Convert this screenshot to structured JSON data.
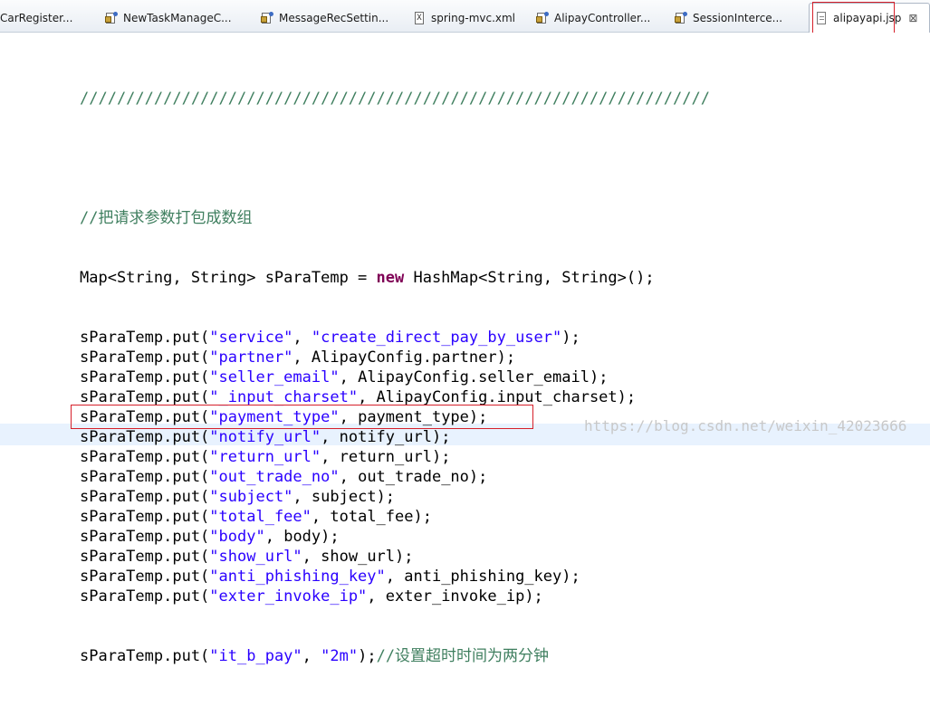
{
  "tabs": [
    {
      "label": "CarRegister...",
      "icon": "java-class-icon"
    },
    {
      "label": "NewTaskManageC...",
      "icon": "java-class-icon"
    },
    {
      "label": "MessageRecSettin...",
      "icon": "java-class-icon"
    },
    {
      "label": "spring-mvc.xml",
      "icon": "xml-file-icon",
      "icon_glyph": "X"
    },
    {
      "label": "AlipayController...",
      "icon": "java-class-icon"
    },
    {
      "label": "SessionInterce...",
      "icon": "java-class-icon"
    },
    {
      "label": "alipayapi.jsp",
      "icon": "jsp-file-icon",
      "active": true,
      "close_glyph": "⊠"
    }
  ],
  "editor": {
    "separator": "////////////////////////////////////////////////////////////////////",
    "comment_pack": "//把请求参数打包成数组",
    "map_decl": {
      "prefix": "Map<String, String> sParaTemp = ",
      "keyword": "new",
      "suffix": " HashMap<String, String>();"
    },
    "put_prefix": "sParaTemp.put(",
    "puts": [
      {
        "key": "\"service\"",
        "sep": ", ",
        "value": "\"create_direct_pay_by_user\"",
        "value_is_string": true,
        "end": ");"
      },
      {
        "key": "\"partner\"",
        "sep": ", ",
        "value": "AlipayConfig.partner",
        "value_is_string": false,
        "end": ");"
      },
      {
        "key": "\"seller_email\"",
        "sep": ", ",
        "value": "AlipayConfig.seller_email",
        "value_is_string": false,
        "end": ");"
      },
      {
        "key": "\"_input_charset\"",
        "sep": ", ",
        "value": "AlipayConfig.input_charset",
        "value_is_string": false,
        "end": ");"
      },
      {
        "key": "\"payment_type\"",
        "sep": ", ",
        "value": "payment_type",
        "value_is_string": false,
        "end": ");"
      },
      {
        "key": "\"notify_url\"",
        "sep": ", ",
        "value": "notify_url",
        "value_is_string": false,
        "end": ");"
      },
      {
        "key": "\"return_url\"",
        "sep": ", ",
        "value": "return_url",
        "value_is_string": false,
        "end": ");"
      },
      {
        "key": "\"out_trade_no\"",
        "sep": ", ",
        "value": "out_trade_no",
        "value_is_string": false,
        "end": ");"
      },
      {
        "key": "\"subject\"",
        "sep": ", ",
        "value": "subject",
        "value_is_string": false,
        "end": ");"
      },
      {
        "key": "\"total_fee\"",
        "sep": ", ",
        "value": "total_fee",
        "value_is_string": false,
        "end": ");"
      },
      {
        "key": "\"body\"",
        "sep": ", ",
        "value": "body",
        "value_is_string": false,
        "end": ");"
      },
      {
        "key": "\"show_url\"",
        "sep": ", ",
        "value": "show_url",
        "value_is_string": false,
        "end": ");"
      },
      {
        "key": "\"anti_phishing_key\"",
        "sep": ", ",
        "value": "anti_phishing_key",
        "value_is_string": false,
        "end": ");"
      },
      {
        "key": "\"exter_invoke_ip\"",
        "sep": ", ",
        "value": "exter_invoke_ip",
        "value_is_string": false,
        "end": ");"
      }
    ],
    "last_put": {
      "key": "\"it_b_pay\"",
      "sep": ", ",
      "value": "\"2m\"",
      "end": ");",
      "comment": "//设置超时时间为两分钟"
    }
  },
  "watermark": "https://blog.csdn.net/weixin_42023666",
  "colors": {
    "comment": "#3f7f5f",
    "string": "#2a00ff",
    "keyword": "#7f0055",
    "highlight_box": "#d6202a",
    "current_line": "#e8f2fe"
  }
}
